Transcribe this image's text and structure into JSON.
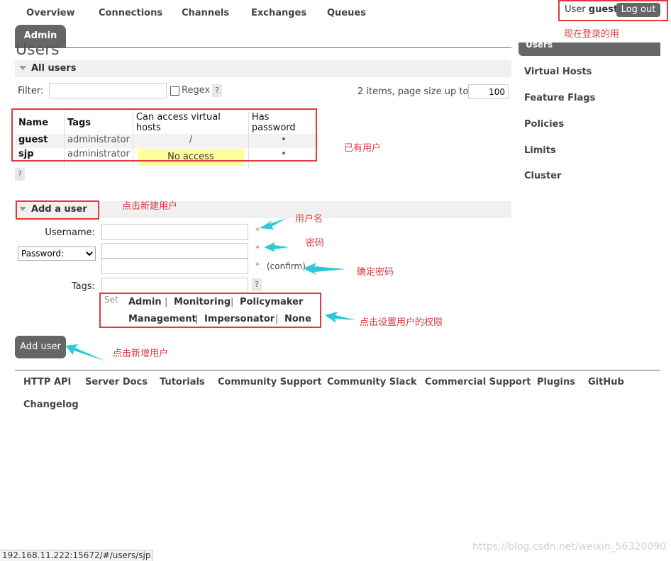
{
  "nav": {
    "tabs": [
      "Overview",
      "Connections",
      "Channels",
      "Exchanges",
      "Queues"
    ],
    "active_tab": "Admin"
  },
  "user_box": {
    "prefix": "User",
    "username": "guest",
    "logout_label": "Log out"
  },
  "page_title": "Users",
  "all_users": {
    "section_label": "All users",
    "filter_label": "Filter:",
    "filter_value": "",
    "regex_label": "Regex",
    "help_label": "?",
    "items_text": "2 items, page size up to",
    "page_size": "100",
    "table": {
      "headers": [
        "Name",
        "Tags",
        "Can access virtual hosts",
        "Has password"
      ],
      "rows": [
        {
          "name": "guest",
          "tags": "administrator",
          "vhosts": "/",
          "has_password": "•"
        },
        {
          "name": "sjp",
          "tags": "administrator",
          "vhosts": "No access",
          "has_password": "•"
        }
      ]
    },
    "table_help": "?"
  },
  "add_user": {
    "section_label": "Add a user",
    "username_label": "Username:",
    "password_select": "Password:",
    "confirm_label": "(confirm)",
    "tags_label": "Tags:",
    "required_mark": "*",
    "set_label": "Set",
    "permissions": [
      "Admin",
      "Monitoring",
      "Policymaker",
      "Management",
      "Impersonator",
      "None"
    ],
    "separator": "|",
    "button_label": "Add user"
  },
  "sidebar": {
    "items": [
      "Users",
      "Virtual Hosts",
      "Feature Flags",
      "Policies",
      "Limits",
      "Cluster"
    ]
  },
  "footer": {
    "links": [
      "HTTP API",
      "Server Docs",
      "Tutorials",
      "Community Support",
      "Community Slack",
      "Commercial Support",
      "Plugins",
      "GitHub",
      "Changelog"
    ]
  },
  "status_url": "192.168.11.222:15672/#/users/sjp",
  "watermark": "https://blog.csdn.net/weixin_56320090",
  "annotations": {
    "logged_in": "现在登录的用",
    "existing_users": "已有用户",
    "click_new_user": "点击新建用户",
    "username": "用户名",
    "password": "密码",
    "confirm_password": "确定密码",
    "set_permissions": "点击设置用户的权限",
    "click_add_user": "点击新增用户"
  },
  "colors": {
    "annotation_red": "#e0393e",
    "arrow_cyan": "#2ec9d6",
    "tab_gray": "#666666",
    "highlight_yellow": "#ffff99"
  }
}
